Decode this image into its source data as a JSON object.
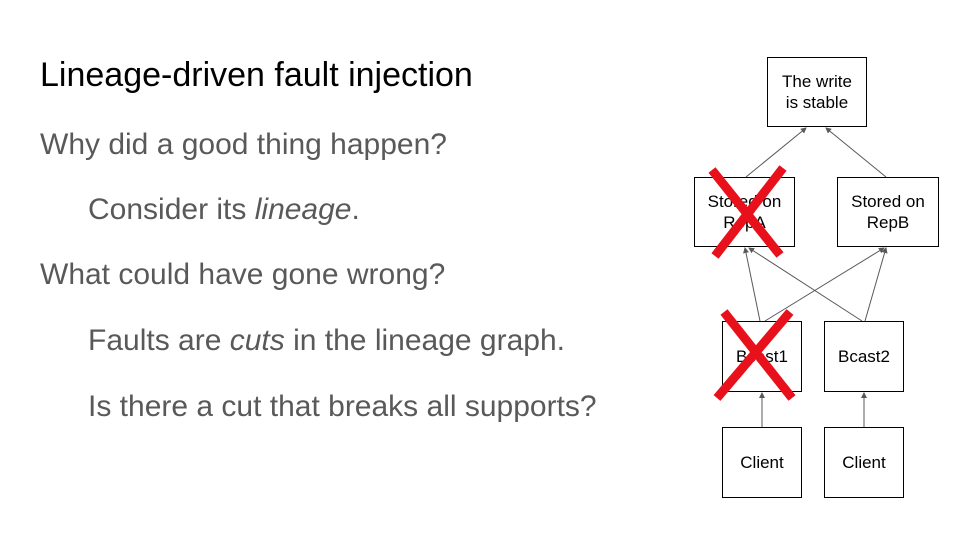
{
  "slide": {
    "title": "Lineage-driven fault injection",
    "bullet1": "Why did a good thing happen?",
    "bullet2_prefix": "Consider its ",
    "bullet2_em": "lineage",
    "bullet2_suffix": ".",
    "bullet3": "What could have gone wrong?",
    "bullet4_prefix": "Faults are ",
    "bullet4_em": "cuts",
    "bullet4_suffix": " in the lineage graph.",
    "bullet5": "Is there a cut that breaks all supports?"
  },
  "graph": {
    "nodes": {
      "stable": "The write\nis stable",
      "repa": "Stored on\nRepA",
      "repb": "Stored on\nRepB",
      "bcast1": "Bcast1",
      "bcast2": "Bcast2",
      "client1": "Client",
      "client2": "Client"
    },
    "failed_nodes": [
      "repa",
      "bcast1"
    ],
    "colors": {
      "edge": "#595959",
      "cross": "#e8101a"
    }
  }
}
